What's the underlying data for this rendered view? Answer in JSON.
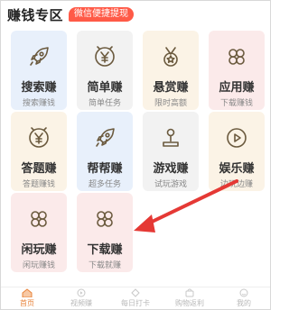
{
  "header": {
    "title": "赚钱专区",
    "badge": "微信便捷提现"
  },
  "cards": [
    {
      "name": "搜索赚",
      "sub": "搜索赚钱",
      "icon": "rocket-icon"
    },
    {
      "name": "简单赚",
      "sub": "简单任务",
      "icon": "yen-coin-icon"
    },
    {
      "name": "悬赏赚",
      "sub": "限时高额",
      "icon": "medal-icon"
    },
    {
      "name": "应用赚",
      "sub": "下载赚钱",
      "icon": "clover-icon"
    },
    {
      "name": "答题赚",
      "sub": "答题赚钱",
      "icon": "yen-coin-icon"
    },
    {
      "name": "帮帮赚",
      "sub": "超多任务",
      "icon": "rocket-icon"
    },
    {
      "name": "游戏赚",
      "sub": "试玩游戏",
      "icon": "joystick-icon"
    },
    {
      "name": "娱乐赚",
      "sub": "边玩边赚",
      "icon": "play-icon"
    },
    {
      "name": "闲玩赚",
      "sub": "闲玩赚钱",
      "icon": "clover-icon"
    },
    {
      "name": "下载赚",
      "sub": "下载就赚",
      "icon": "clover-icon"
    }
  ],
  "tabs": [
    {
      "label": "首页",
      "icon": "home-icon",
      "active": true
    },
    {
      "label": "视频赚",
      "icon": "video-icon",
      "active": false
    },
    {
      "label": "每日打卡",
      "icon": "checkin-icon",
      "active": false
    },
    {
      "label": "购物返利",
      "icon": "shopping-icon",
      "active": false
    },
    {
      "label": "我的",
      "icon": "profile-icon",
      "active": false
    }
  ],
  "colors": {
    "accent": "#e8833a",
    "badge": "#ff5a47",
    "arrow": "#e53935",
    "icon_stroke": "#6b5a3e"
  }
}
